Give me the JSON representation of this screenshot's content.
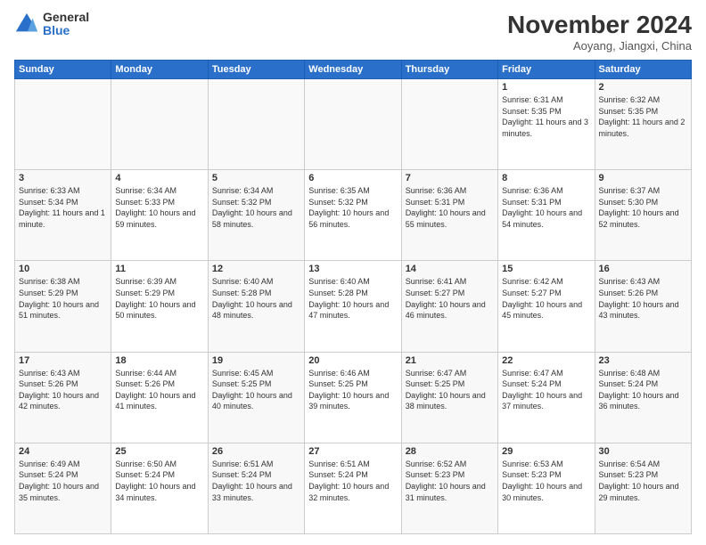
{
  "logo": {
    "general": "General",
    "blue": "Blue"
  },
  "header": {
    "title": "November 2024",
    "location": "Aoyang, Jiangxi, China"
  },
  "weekdays": [
    "Sunday",
    "Monday",
    "Tuesday",
    "Wednesday",
    "Thursday",
    "Friday",
    "Saturday"
  ],
  "weeks": [
    [
      {
        "day": "",
        "info": ""
      },
      {
        "day": "",
        "info": ""
      },
      {
        "day": "",
        "info": ""
      },
      {
        "day": "",
        "info": ""
      },
      {
        "day": "",
        "info": ""
      },
      {
        "day": "1",
        "info": "Sunrise: 6:31 AM\nSunset: 5:35 PM\nDaylight: 11 hours and 3 minutes."
      },
      {
        "day": "2",
        "info": "Sunrise: 6:32 AM\nSunset: 5:35 PM\nDaylight: 11 hours and 2 minutes."
      }
    ],
    [
      {
        "day": "3",
        "info": "Sunrise: 6:33 AM\nSunset: 5:34 PM\nDaylight: 11 hours and 1 minute."
      },
      {
        "day": "4",
        "info": "Sunrise: 6:34 AM\nSunset: 5:33 PM\nDaylight: 10 hours and 59 minutes."
      },
      {
        "day": "5",
        "info": "Sunrise: 6:34 AM\nSunset: 5:32 PM\nDaylight: 10 hours and 58 minutes."
      },
      {
        "day": "6",
        "info": "Sunrise: 6:35 AM\nSunset: 5:32 PM\nDaylight: 10 hours and 56 minutes."
      },
      {
        "day": "7",
        "info": "Sunrise: 6:36 AM\nSunset: 5:31 PM\nDaylight: 10 hours and 55 minutes."
      },
      {
        "day": "8",
        "info": "Sunrise: 6:36 AM\nSunset: 5:31 PM\nDaylight: 10 hours and 54 minutes."
      },
      {
        "day": "9",
        "info": "Sunrise: 6:37 AM\nSunset: 5:30 PM\nDaylight: 10 hours and 52 minutes."
      }
    ],
    [
      {
        "day": "10",
        "info": "Sunrise: 6:38 AM\nSunset: 5:29 PM\nDaylight: 10 hours and 51 minutes."
      },
      {
        "day": "11",
        "info": "Sunrise: 6:39 AM\nSunset: 5:29 PM\nDaylight: 10 hours and 50 minutes."
      },
      {
        "day": "12",
        "info": "Sunrise: 6:40 AM\nSunset: 5:28 PM\nDaylight: 10 hours and 48 minutes."
      },
      {
        "day": "13",
        "info": "Sunrise: 6:40 AM\nSunset: 5:28 PM\nDaylight: 10 hours and 47 minutes."
      },
      {
        "day": "14",
        "info": "Sunrise: 6:41 AM\nSunset: 5:27 PM\nDaylight: 10 hours and 46 minutes."
      },
      {
        "day": "15",
        "info": "Sunrise: 6:42 AM\nSunset: 5:27 PM\nDaylight: 10 hours and 45 minutes."
      },
      {
        "day": "16",
        "info": "Sunrise: 6:43 AM\nSunset: 5:26 PM\nDaylight: 10 hours and 43 minutes."
      }
    ],
    [
      {
        "day": "17",
        "info": "Sunrise: 6:43 AM\nSunset: 5:26 PM\nDaylight: 10 hours and 42 minutes."
      },
      {
        "day": "18",
        "info": "Sunrise: 6:44 AM\nSunset: 5:26 PM\nDaylight: 10 hours and 41 minutes."
      },
      {
        "day": "19",
        "info": "Sunrise: 6:45 AM\nSunset: 5:25 PM\nDaylight: 10 hours and 40 minutes."
      },
      {
        "day": "20",
        "info": "Sunrise: 6:46 AM\nSunset: 5:25 PM\nDaylight: 10 hours and 39 minutes."
      },
      {
        "day": "21",
        "info": "Sunrise: 6:47 AM\nSunset: 5:25 PM\nDaylight: 10 hours and 38 minutes."
      },
      {
        "day": "22",
        "info": "Sunrise: 6:47 AM\nSunset: 5:24 PM\nDaylight: 10 hours and 37 minutes."
      },
      {
        "day": "23",
        "info": "Sunrise: 6:48 AM\nSunset: 5:24 PM\nDaylight: 10 hours and 36 minutes."
      }
    ],
    [
      {
        "day": "24",
        "info": "Sunrise: 6:49 AM\nSunset: 5:24 PM\nDaylight: 10 hours and 35 minutes."
      },
      {
        "day": "25",
        "info": "Sunrise: 6:50 AM\nSunset: 5:24 PM\nDaylight: 10 hours and 34 minutes."
      },
      {
        "day": "26",
        "info": "Sunrise: 6:51 AM\nSunset: 5:24 PM\nDaylight: 10 hours and 33 minutes."
      },
      {
        "day": "27",
        "info": "Sunrise: 6:51 AM\nSunset: 5:24 PM\nDaylight: 10 hours and 32 minutes."
      },
      {
        "day": "28",
        "info": "Sunrise: 6:52 AM\nSunset: 5:23 PM\nDaylight: 10 hours and 31 minutes."
      },
      {
        "day": "29",
        "info": "Sunrise: 6:53 AM\nSunset: 5:23 PM\nDaylight: 10 hours and 30 minutes."
      },
      {
        "day": "30",
        "info": "Sunrise: 6:54 AM\nSunset: 5:23 PM\nDaylight: 10 hours and 29 minutes."
      }
    ]
  ]
}
